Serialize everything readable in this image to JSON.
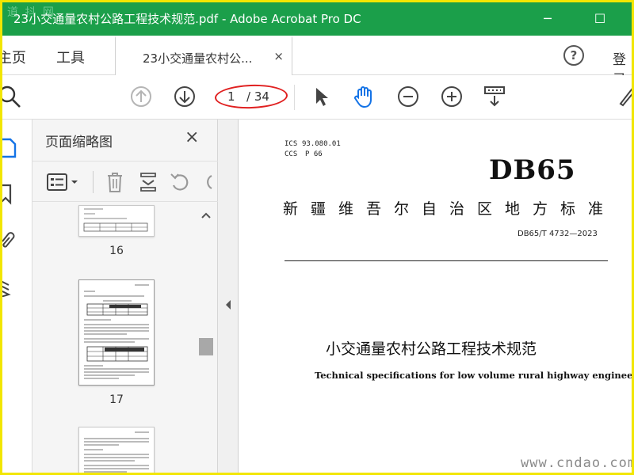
{
  "window": {
    "title": "23小交通量农村公路工程技术规范.pdf - Adobe Acrobat Pro DC",
    "watermark": "道 抖 网",
    "minimize": "─",
    "maximize": "☐"
  },
  "menubar": {
    "home": "主页",
    "tools": "工具",
    "tab_label": "23小交通量农村公...",
    "tab_close": "×",
    "help": "?",
    "signin": "登录"
  },
  "toolbar": {
    "current_page": "1",
    "total_pages": "/ 34"
  },
  "thumbnails_panel": {
    "title": "页面缩略图",
    "close": "×",
    "pages": [
      "16",
      "17"
    ]
  },
  "document": {
    "ics_label": "ICS",
    "ics_value": "93.080.01",
    "ccs_label": "CCS",
    "ccs_value": "P 66",
    "db_mark": "DB65",
    "standard_type": "新疆维吾尔自治区地方标准",
    "standard_number": "DB65/T 4732—2023",
    "title_cn": "小交通量农村公路工程技术规范",
    "title_en": "Technical specifications for low volume rural highway engineering"
  },
  "site_watermark": "www.cndao.com",
  "colors": {
    "titlebar": "#1b9f4a",
    "accent_blue": "#1473e6",
    "highlight_oval": "#e02020",
    "frame": "#f2e600"
  }
}
